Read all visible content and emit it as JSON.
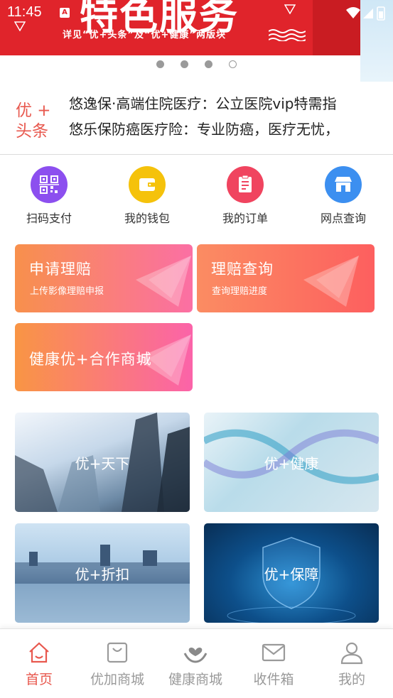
{
  "status_bar": {
    "time": "11:45",
    "notification_icon_letter": "A"
  },
  "banner": {
    "title": "特色服务",
    "subtitle": "详见“优+头条”及“优+健康”两版块",
    "colors": {
      "background": "#e0242b",
      "text": "#ffffff"
    }
  },
  "carousel": {
    "page_count": 4,
    "active_index": 3
  },
  "headlines": {
    "logo": "优+头条",
    "logo_line1": "优 +",
    "logo_line2": "头条",
    "items": [
      "悠逸保·高端住院医疗：公立医院vip特需指",
      "悠乐保防癌医疗险：专业防癌，医疗无忧，"
    ]
  },
  "quick_actions": [
    {
      "label": "扫码支付",
      "icon": "qr-code-icon",
      "color": "#8c4fef"
    },
    {
      "label": "我的钱包",
      "icon": "wallet-icon",
      "color": "#f5c20b"
    },
    {
      "label": "我的订单",
      "icon": "order-icon",
      "color": "#f0445f"
    },
    {
      "label": "网点查询",
      "icon": "store-icon",
      "color": "#3c8ff0"
    }
  ],
  "service_cards": [
    {
      "title": "申请理赔",
      "subtitle": "上传影像理赔申报"
    },
    {
      "title": "理赔查询",
      "subtitle": "查询理赔进度"
    },
    {
      "title": "健康优+合作商城",
      "subtitle": ""
    }
  ],
  "feature_tiles": [
    {
      "label": "优+天下"
    },
    {
      "label": "优+健康"
    },
    {
      "label": "优+折扣"
    },
    {
      "label": "优+保障"
    }
  ],
  "tab_bar": {
    "active_color": "#e8584e",
    "inactive_color": "#9a9a9a",
    "tabs": [
      {
        "label": "首页",
        "icon": "home-icon",
        "active": true
      },
      {
        "label": "优加商城",
        "icon": "shopping-bag-icon",
        "active": false
      },
      {
        "label": "健康商城",
        "icon": "heart-hands-icon",
        "active": false
      },
      {
        "label": "收件箱",
        "icon": "mail-icon",
        "active": false
      },
      {
        "label": "我的",
        "icon": "user-icon",
        "active": false
      }
    ]
  }
}
